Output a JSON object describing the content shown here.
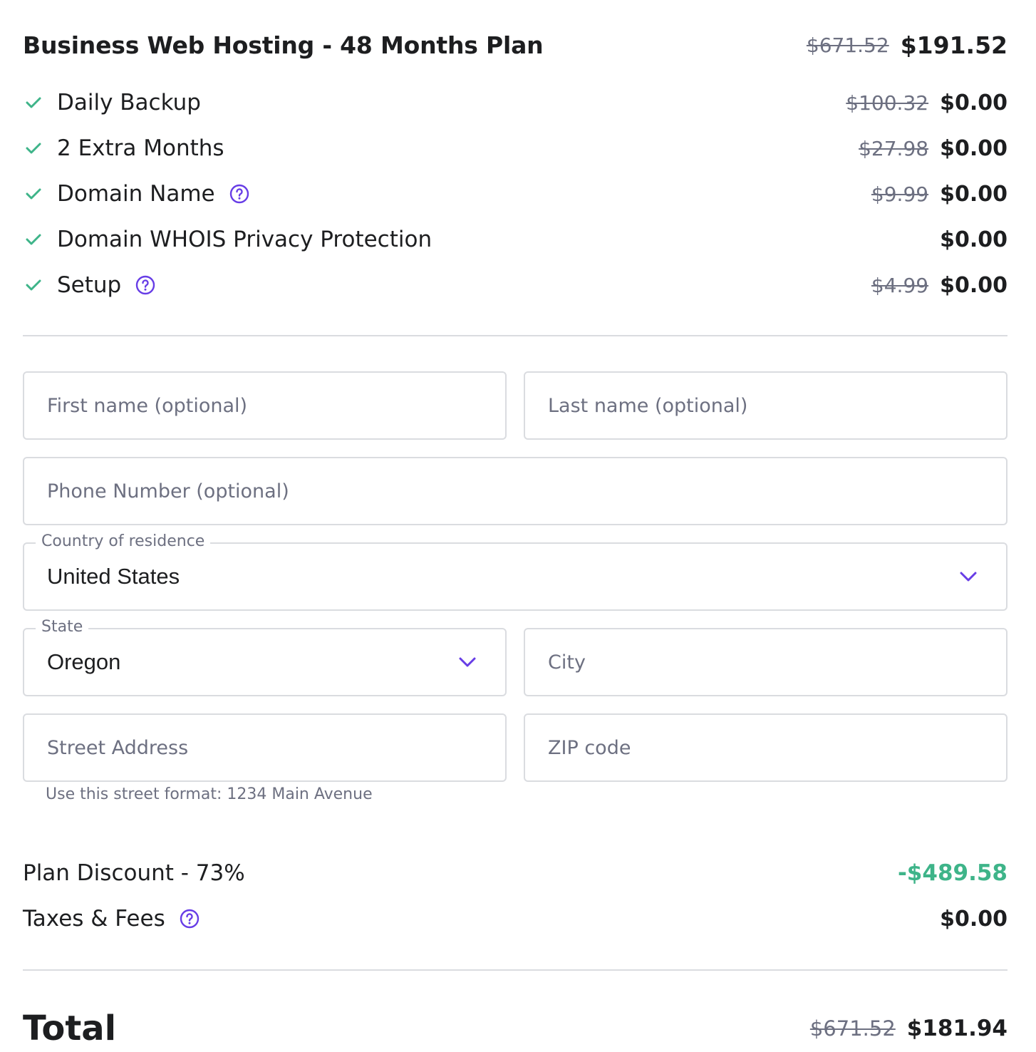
{
  "colors": {
    "check": "#3eb489",
    "help": "#673de6",
    "discount": "#3eb489",
    "chevron": "#673de6",
    "text": "#1d1e20",
    "muted": "#6d7081"
  },
  "plan": {
    "title": "Business Web Hosting - 48 Months Plan",
    "old_price": "$671.52",
    "price": "$191.52"
  },
  "features": [
    {
      "label": "Daily Backup",
      "old_price": "$100.32",
      "price": "$0.00",
      "help": false,
      "icon": "check-icon"
    },
    {
      "label": "2 Extra Months",
      "old_price": "$27.98",
      "price": "$0.00",
      "help": false,
      "icon": "check-icon"
    },
    {
      "label": "Domain Name",
      "old_price": "$9.99",
      "price": "$0.00",
      "help": true,
      "icon": "check-icon"
    },
    {
      "label": "Domain WHOIS Privacy Protection",
      "old_price": "",
      "price": "$0.00",
      "help": false,
      "icon": "check-icon"
    },
    {
      "label": "Setup",
      "old_price": "$4.99",
      "price": "$0.00",
      "help": true,
      "icon": "check-icon"
    }
  ],
  "form": {
    "first_name": {
      "placeholder": "First name (optional)",
      "value": ""
    },
    "last_name": {
      "placeholder": "Last name (optional)",
      "value": ""
    },
    "phone": {
      "placeholder": "Phone Number (optional)",
      "value": ""
    },
    "country": {
      "label": "Country of residence",
      "value": "United States"
    },
    "state": {
      "label": "State",
      "value": "Oregon"
    },
    "city": {
      "placeholder": "City",
      "value": ""
    },
    "street": {
      "placeholder": "Street Address",
      "value": "",
      "helper": "Use this street format: 1234 Main Avenue"
    },
    "zip": {
      "placeholder": "ZIP code",
      "value": ""
    }
  },
  "summary": {
    "discount_label": "Plan Discount - 73%",
    "discount_value": "-$489.58",
    "taxes_label": "Taxes & Fees",
    "taxes_value": "$0.00"
  },
  "total": {
    "label": "Total",
    "old_price": "$671.52",
    "price": "$181.94"
  }
}
